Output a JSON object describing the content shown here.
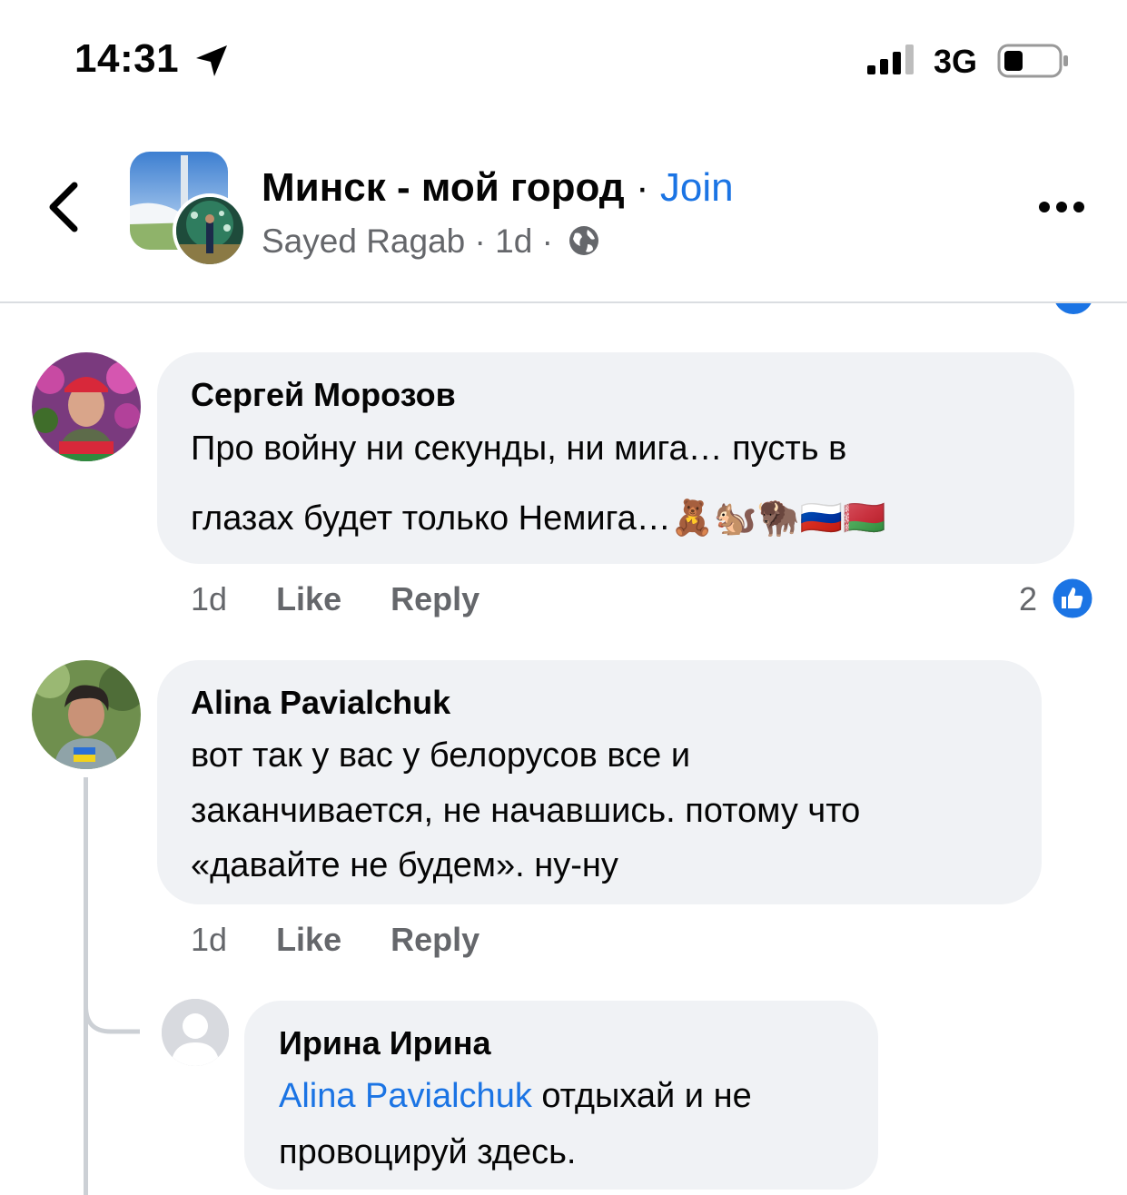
{
  "status_bar": {
    "time": "14:31",
    "network": "3G"
  },
  "header": {
    "group_name": "Минск - мой город",
    "separator": "·",
    "join_label": "Join",
    "author": "Sayed Ragab",
    "time": "1d",
    "icons": [
      "back-chevron-icon",
      "globe-icon",
      "more-dots-icon"
    ]
  },
  "comments": [
    {
      "author": "Сергей Морозов",
      "lines": [
        "Про войну ни секунды, ни мига… пусть в",
        "глазах будет только Немига…🧸🐿️🦬🇷🇺🇧🇾"
      ],
      "time": "1d",
      "like_label": "Like",
      "reply_label": "Reply",
      "reactions_count": "2"
    },
    {
      "author": "Alina Pavialchuk",
      "lines": [
        "вот так у вас у белорусов все и",
        "заканчивается, не начавшись. потому что",
        "«давайте не будем». ну-ну"
      ],
      "time": "1d",
      "like_label": "Like",
      "reply_label": "Reply"
    },
    {
      "author": "Ирина Ирина",
      "mention": "Alina Pavialchuk",
      "lines": [
        " отдыхай и не",
        "провоцируй здесь."
      ]
    }
  ]
}
